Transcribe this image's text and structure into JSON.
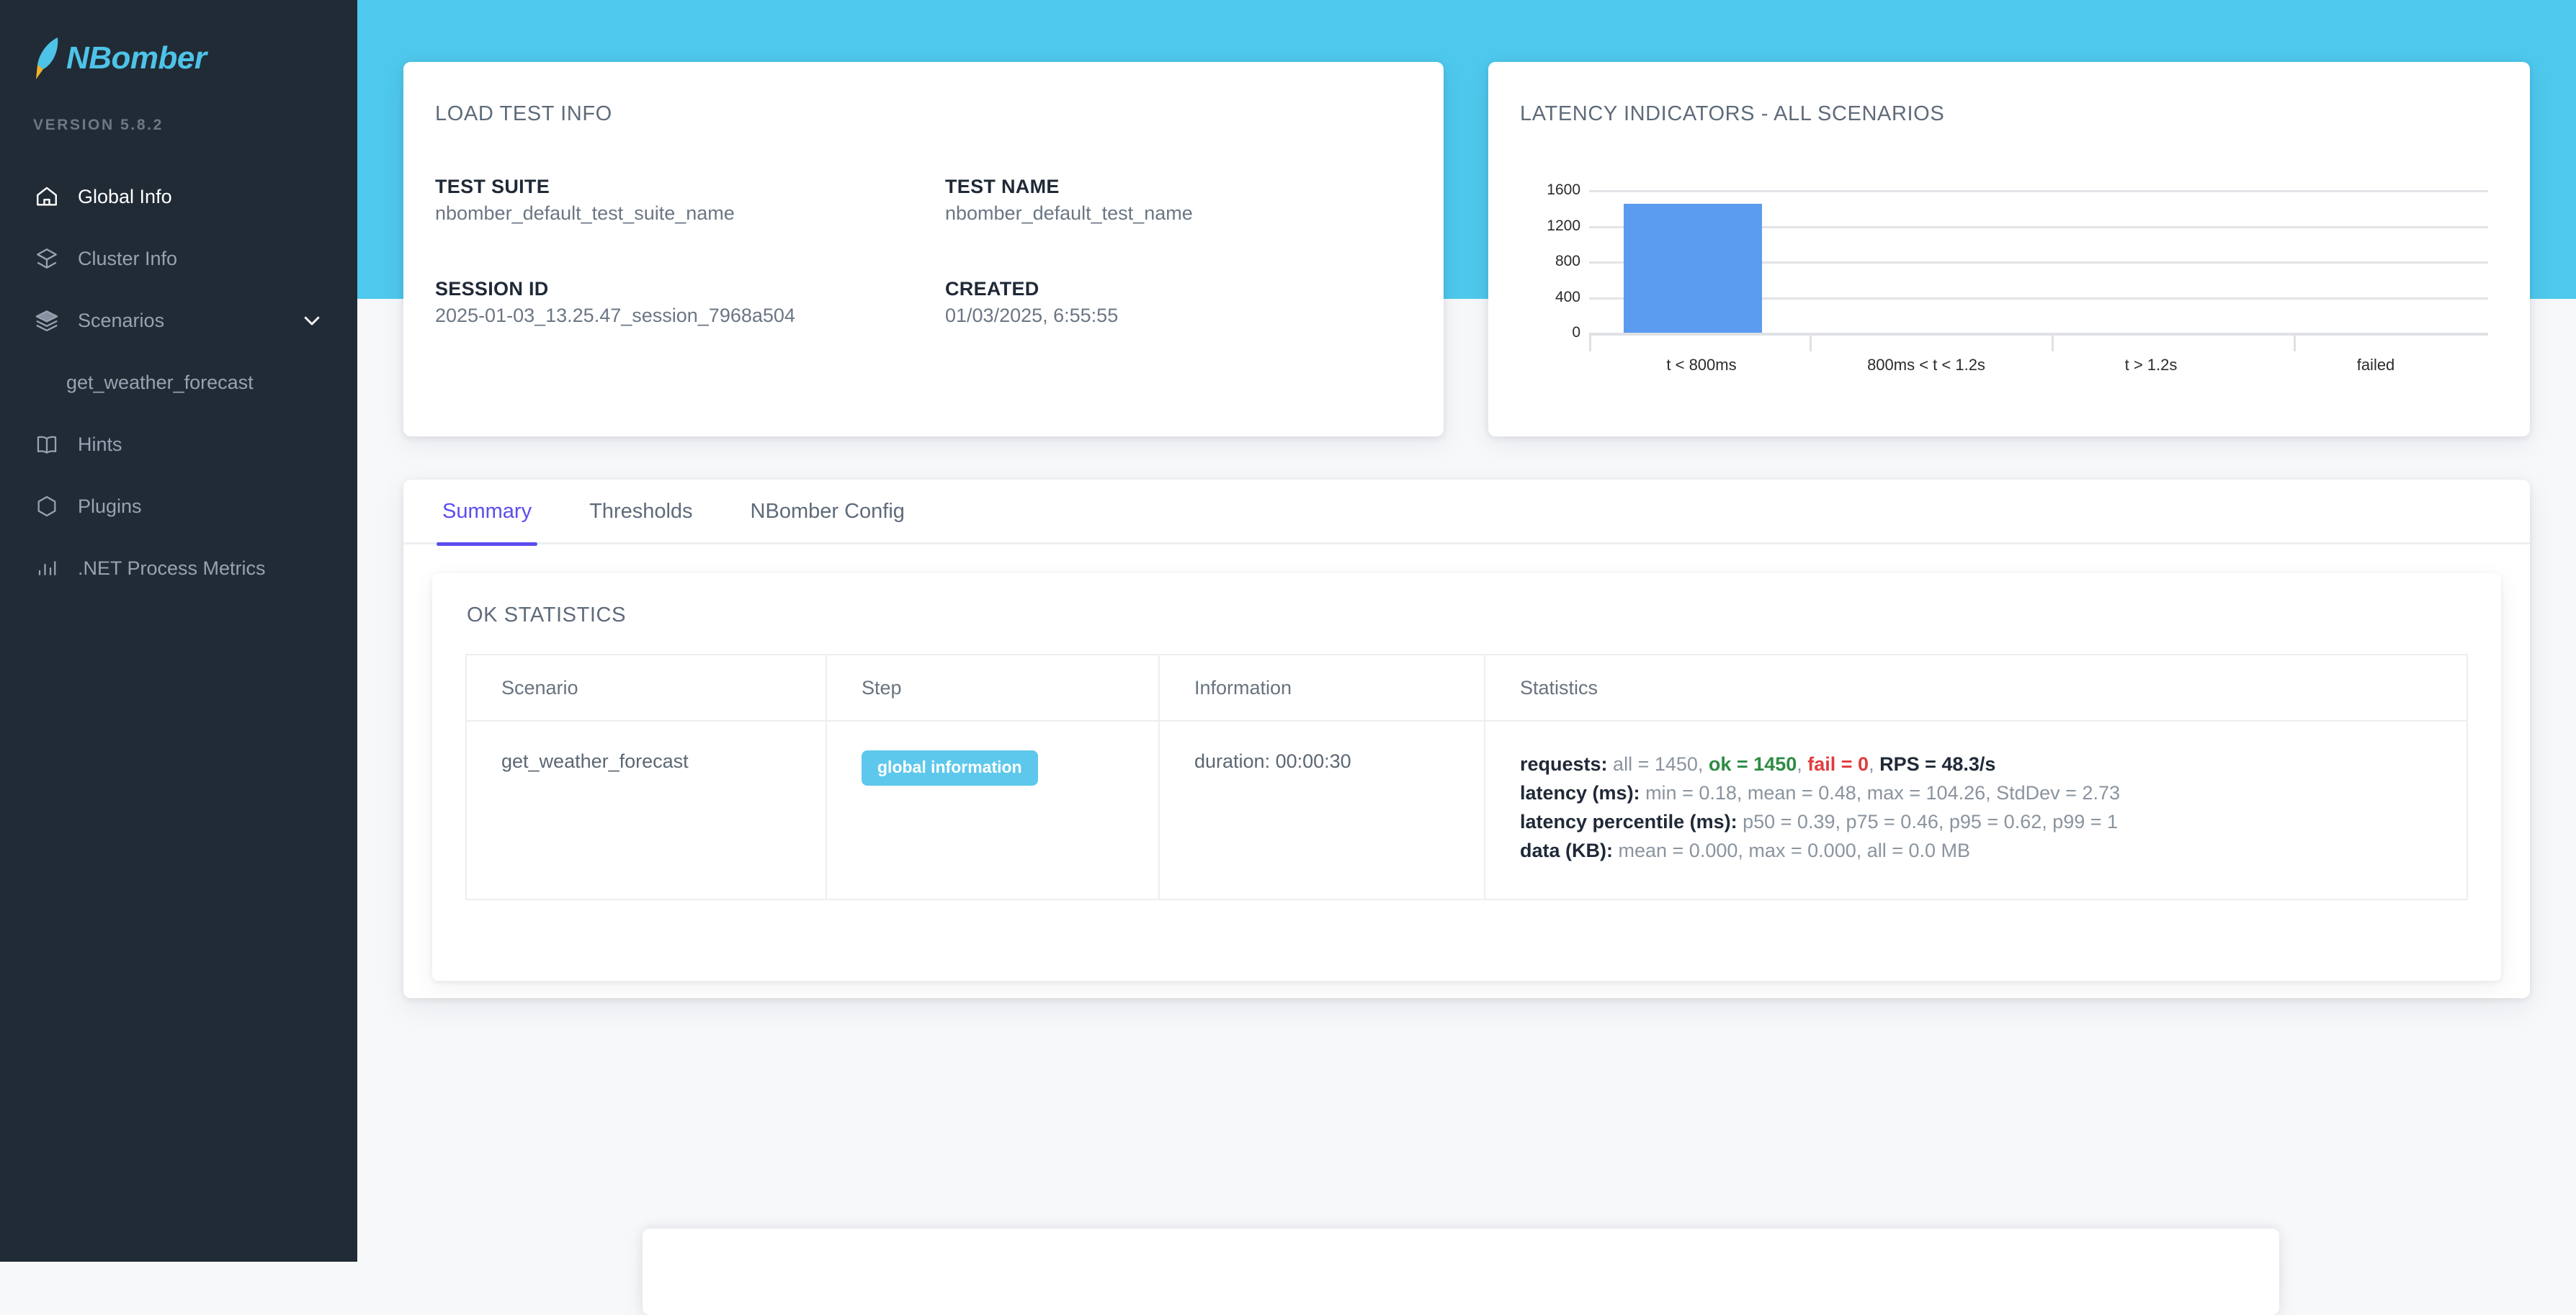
{
  "theme": {
    "sidebar_bg": "#212b36",
    "header_band": "#4ec8ec",
    "page_bg": "#f7f8fa",
    "brand_color": "#4ec3e8",
    "accent_tab": "#5b4dee",
    "bar_color": "#5b9bf0",
    "badge_color": "#5ec8ec",
    "ok_color": "#2e8b45",
    "fail_color": "#e13c3c"
  },
  "sidebar": {
    "brand": "NBomber",
    "brand_icon": "rocket-icon",
    "version": "VERSION 5.8.2",
    "items": [
      {
        "label": "Global Info",
        "icon": "home-icon",
        "active": true
      },
      {
        "label": "Cluster Info",
        "icon": "cluster-icon",
        "active": false
      },
      {
        "label": "Scenarios",
        "icon": "layers-icon",
        "active": false,
        "expandable": true,
        "chevron": "chevron-down-icon"
      },
      {
        "label": "get_weather_forecast",
        "icon": "",
        "active": false,
        "sub": true
      },
      {
        "label": "Hints",
        "icon": "book-icon",
        "active": false
      },
      {
        "label": "Plugins",
        "icon": "hexagon-icon",
        "active": false
      },
      {
        "label": ".NET Process Metrics",
        "icon": "bar-chart-icon",
        "active": false
      }
    ]
  },
  "load_test_info": {
    "title": "LOAD TEST INFO",
    "fields": [
      {
        "label": "TEST SUITE",
        "value": "nbomber_default_test_suite_name"
      },
      {
        "label": "TEST NAME",
        "value": "nbomber_default_test_name"
      },
      {
        "label": "SESSION ID",
        "value": "2025-01-03_13.25.47_session_7968a504"
      },
      {
        "label": "CREATED",
        "value": "01/03/2025, 6:55:55"
      }
    ]
  },
  "latency_card": {
    "title": "LATENCY INDICATORS - ALL SCENARIOS"
  },
  "chart_data": {
    "type": "bar",
    "title": "LATENCY INDICATORS - ALL SCENARIOS",
    "xlabel": "",
    "ylabel": "",
    "categories": [
      "t < 800ms",
      "800ms < t < 1.2s",
      "t > 1.2s",
      "failed"
    ],
    "values": [
      1450,
      0,
      0,
      0
    ],
    "ylim": [
      0,
      1600
    ],
    "yticks": [
      0,
      400,
      800,
      1200,
      1600
    ],
    "grid": true,
    "legend": false,
    "series": [
      {
        "name": "requests",
        "values": [
          1450,
          0,
          0,
          0
        ],
        "color": "#5b9bf0"
      }
    ]
  },
  "tabs": [
    {
      "label": "Summary",
      "active": true
    },
    {
      "label": "Thresholds",
      "active": false
    },
    {
      "label": "NBomber Config",
      "active": false
    }
  ],
  "ok_statistics": {
    "title": "OK STATISTICS",
    "columns": [
      "Scenario",
      "Step",
      "Information",
      "Statistics"
    ],
    "rows": [
      {
        "scenario": "get_weather_forecast",
        "step_badge": "global information",
        "information": "duration: 00:00:30",
        "statistics": {
          "requests_label": "requests:",
          "requests_all": " all = 1450, ",
          "requests_ok": "ok = 1450",
          "requests_sep1": ", ",
          "requests_fail": "fail = 0",
          "requests_sep2": ", ",
          "requests_rps": "RPS = 48.3/s",
          "latency_label": "latency (ms):",
          "latency_value": " min = 0.18, mean = 0.48, max = 104.26, StdDev = 2.73",
          "percentile_label": "latency percentile (ms):",
          "percentile_value": " p50 = 0.39, p75 = 0.46, p95 = 0.62, p99 = 1",
          "data_label": "data (KB):",
          "data_value": " mean = 0.000, max = 0.000, all = 0.0 MB"
        }
      }
    ]
  }
}
